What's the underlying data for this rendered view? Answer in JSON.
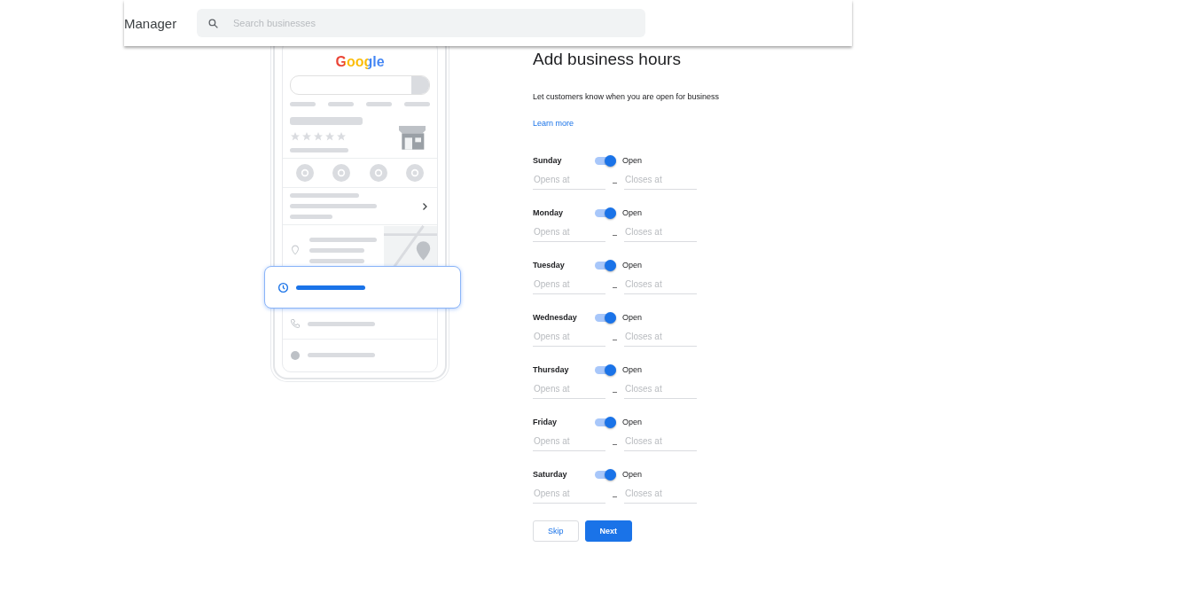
{
  "header": {
    "app_name": "Manager",
    "search": {
      "placeholder": "Search businesses"
    }
  },
  "illustration": {
    "logo": "Google"
  },
  "form": {
    "title": "Add business hours",
    "subtitle": "Let customers know when you are open for business",
    "link": "Learn more",
    "days": [
      {
        "name": "Sunday",
        "on": true,
        "status": "Open",
        "opens": {
          "placeholder": "Opens at"
        },
        "separator": "–",
        "closes": {
          "placeholder": "Closes at"
        }
      },
      {
        "name": "Monday",
        "on": true,
        "status": "Open",
        "opens": {
          "placeholder": "Opens at"
        },
        "separator": "–",
        "closes": {
          "placeholder": "Closes at"
        }
      },
      {
        "name": "Tuesday",
        "on": true,
        "status": "Open",
        "opens": {
          "placeholder": "Opens at"
        },
        "separator": "–",
        "closes": {
          "placeholder": "Closes at"
        }
      },
      {
        "name": "Wednesday",
        "on": true,
        "status": "Open",
        "opens": {
          "placeholder": "Opens at"
        },
        "separator": "–",
        "closes": {
          "placeholder": "Closes at"
        }
      },
      {
        "name": "Thursday",
        "on": true,
        "status": "Open",
        "opens": {
          "placeholder": "Opens at"
        },
        "separator": "–",
        "closes": {
          "placeholder": "Closes at"
        }
      },
      {
        "name": "Friday",
        "on": true,
        "status": "Open",
        "opens": {
          "placeholder": "Opens at"
        },
        "separator": "–",
        "closes": {
          "placeholder": "Closes at"
        }
      },
      {
        "name": "Saturday",
        "on": true,
        "status": "Open",
        "opens": {
          "placeholder": "Opens at"
        },
        "separator": "–",
        "closes": {
          "placeholder": "Closes at"
        }
      }
    ],
    "buttons": [
      {
        "label": "Skip",
        "kind": "secondary"
      },
      {
        "label": "Next",
        "kind": "primary"
      }
    ]
  }
}
